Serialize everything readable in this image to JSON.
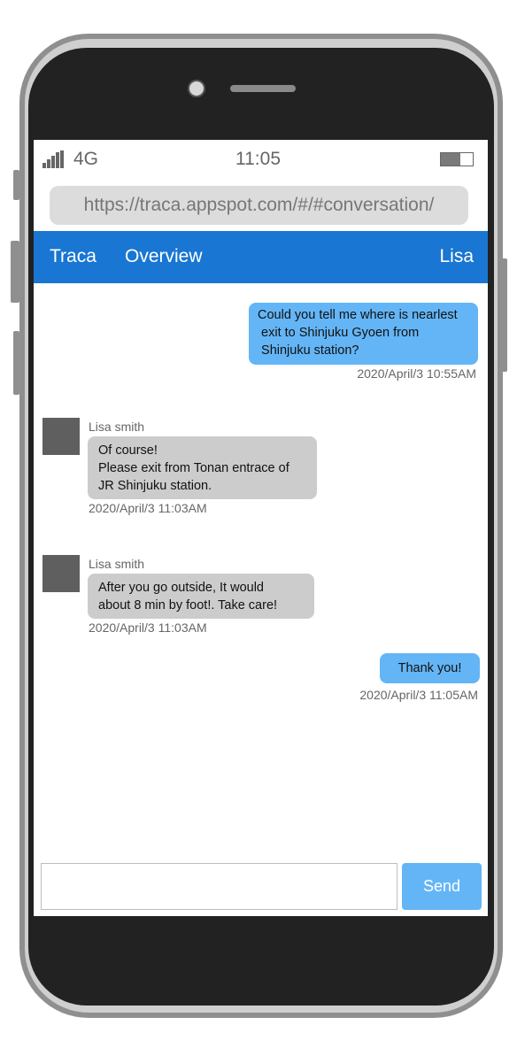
{
  "status_bar": {
    "network": "4G",
    "time": "11:05",
    "battery_level": 0.6
  },
  "browser": {
    "url": "https://traca.appspot.com/#/#conversation/"
  },
  "header": {
    "brand": "Traca",
    "nav_overview": "Overview",
    "user": "Lisa"
  },
  "messages": [
    {
      "direction": "outgoing",
      "lines": [
        "Could you tell me where is nearlest",
        " exit to Shinjuku Gyoen from",
        " Shinjuku station?"
      ],
      "timestamp": "2020/April/3 10:55AM"
    },
    {
      "direction": "incoming",
      "sender": "Lisa smith",
      "lines": [
        "Of course!",
        "Please exit from Tonan entrace of",
        "JR Shinjuku station."
      ],
      "timestamp": "2020/April/3 11:03AM"
    },
    {
      "direction": "incoming",
      "sender": "Lisa smith",
      "lines": [
        "After you go outside, It would",
        "about 8 min by foot!. Take care!"
      ],
      "timestamp": "2020/April/3 11:03AM"
    },
    {
      "direction": "outgoing",
      "lines": [
        "Thank you!"
      ],
      "timestamp": "2020/April/3 11:05AM"
    }
  ],
  "composer": {
    "input_value": "",
    "send_label": "Send"
  },
  "colors": {
    "header": "#1976d2",
    "outgoing_bubble": "#64b5f6",
    "incoming_bubble": "#cccccc",
    "send_button": "#64b5f6"
  },
  "icons": {
    "signal": "signal-bars-icon",
    "battery": "battery-icon",
    "avatar": "avatar-placeholder"
  }
}
